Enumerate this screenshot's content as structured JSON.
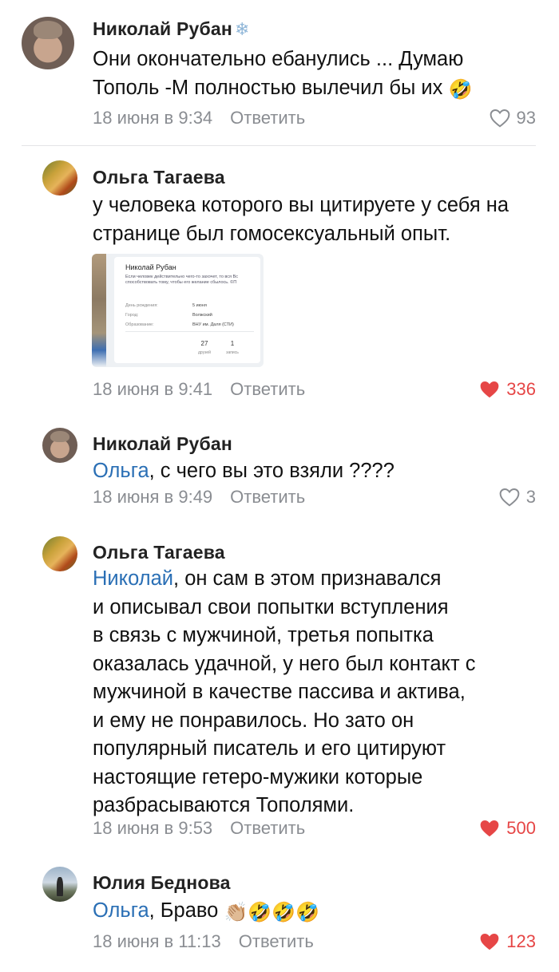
{
  "ui": {
    "reply_label": "Ответить",
    "snowflake": "❄",
    "emoji_rofl": "🤣",
    "emoji_clap": "👏🏼",
    "colors": {
      "link": "#2a6fb5",
      "like_active": "#e64646",
      "meta": "#8a8d92"
    }
  },
  "comments": [
    {
      "author": "Николай Рубан",
      "text": "Они окончательно ебанулись ... Думаю Тополь -М полностью вылечил бы их",
      "time": "18 июня в 9:34",
      "likes": "93",
      "liked": false
    },
    {
      "author": "Ольга Тагаева",
      "text": "у человека которого вы цитируете у себя на странице был гомосексуальный опыт.",
      "time": "18 июня в 9:41",
      "likes": "336",
      "liked": true,
      "attachment": {
        "profile_name": "Николай Рубан",
        "status": "Если человек действительно чего-то захочет, то вся Вс способствовать тому, чтобы его желание сбылось. ©П",
        "rows": [
          {
            "label": "День рождения:",
            "value": "5 июня"
          },
          {
            "label": "Город:",
            "value": "Волжский"
          },
          {
            "label": "Образование:",
            "value": "ВНУ им. Даля (СТИ)"
          }
        ],
        "counters": [
          {
            "num": "27",
            "label": "друзей"
          },
          {
            "num": "1",
            "label": "запись"
          }
        ]
      }
    },
    {
      "author": "Николай Рубан",
      "mention": "Ольга",
      "text": ", с чего вы это взяли ????",
      "time": "18 июня в 9:49",
      "likes": "3",
      "liked": false
    },
    {
      "author": "Ольга Тагаева",
      "mention": "Николай",
      "lines": [
        ", он сам в этом признавался",
        "и описывал свои попытки вступления",
        "в связь с мужчиной, третья попытка",
        "оказалась удачной, у него был контакт с",
        "мужчиной в качестве пассива и актива,",
        "и ему не понравилось. Но зато он",
        "популярный писатель и его цитируют",
        "настоящие гетеро-мужики которые",
        "разбрасываются Тополями."
      ],
      "time": "18 июня в 9:53",
      "likes": "500",
      "liked": true
    },
    {
      "author": "Юлия Беднова",
      "mention": "Ольга",
      "text": ", Браво",
      "time": "18 июня в 11:13",
      "likes": "123",
      "liked": true
    }
  ]
}
